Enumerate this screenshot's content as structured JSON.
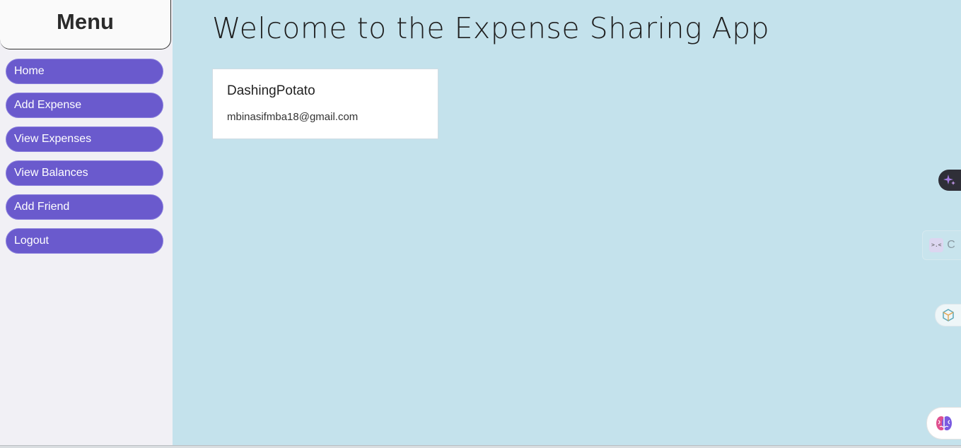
{
  "sidebar": {
    "title": "Menu",
    "items": [
      {
        "label": "Home"
      },
      {
        "label": "Add Expense"
      },
      {
        "label": "View Expenses"
      },
      {
        "label": "View Balances"
      },
      {
        "label": "Add Friend"
      },
      {
        "label": "Logout"
      }
    ]
  },
  "main": {
    "title": "Welcome to the Expense Sharing App",
    "user": {
      "name": "DashingPotato",
      "email": "mbinasifmba18@gmail.com"
    }
  },
  "floating_tools": {
    "cmd_text": "C"
  },
  "colors": {
    "sidebar_bg": "#f1f0f5",
    "nav_button": "#6a5acd",
    "main_bg": "#c4e2ec",
    "card_bg": "#ffffff"
  }
}
